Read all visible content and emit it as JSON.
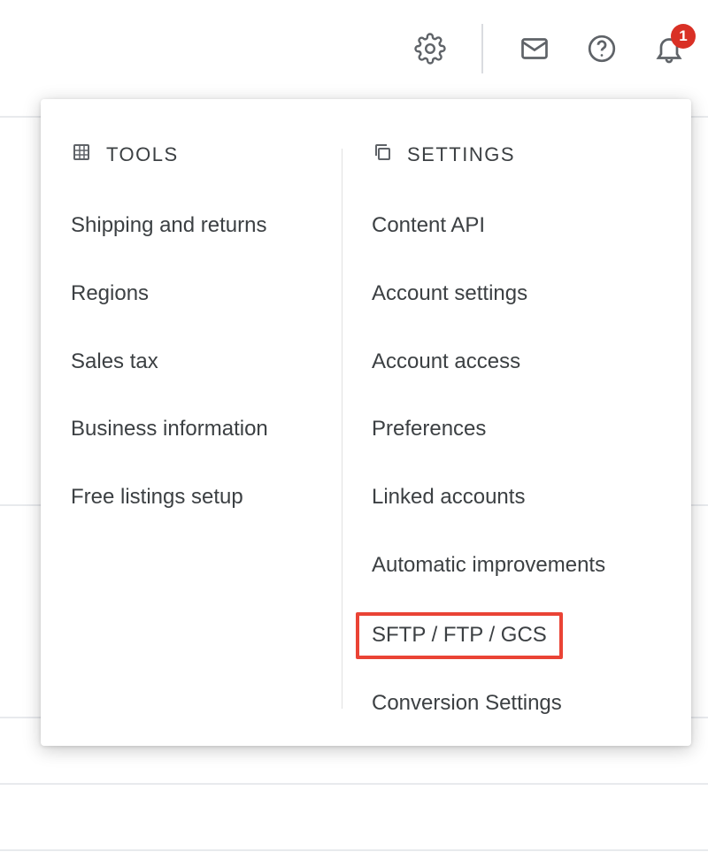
{
  "topbar": {
    "notifications_count": "1"
  },
  "panel": {
    "tools": {
      "header": "TOOLS",
      "items": [
        "Shipping and returns",
        "Regions",
        "Sales tax",
        "Business information",
        "Free listings setup"
      ]
    },
    "settings": {
      "header": "SETTINGS",
      "items": [
        "Content API",
        "Account settings",
        "Account access",
        "Preferences",
        "Linked accounts",
        "Automatic improvements",
        "SFTP / FTP / GCS",
        "Conversion Settings"
      ],
      "highlighted_index": 6
    }
  }
}
